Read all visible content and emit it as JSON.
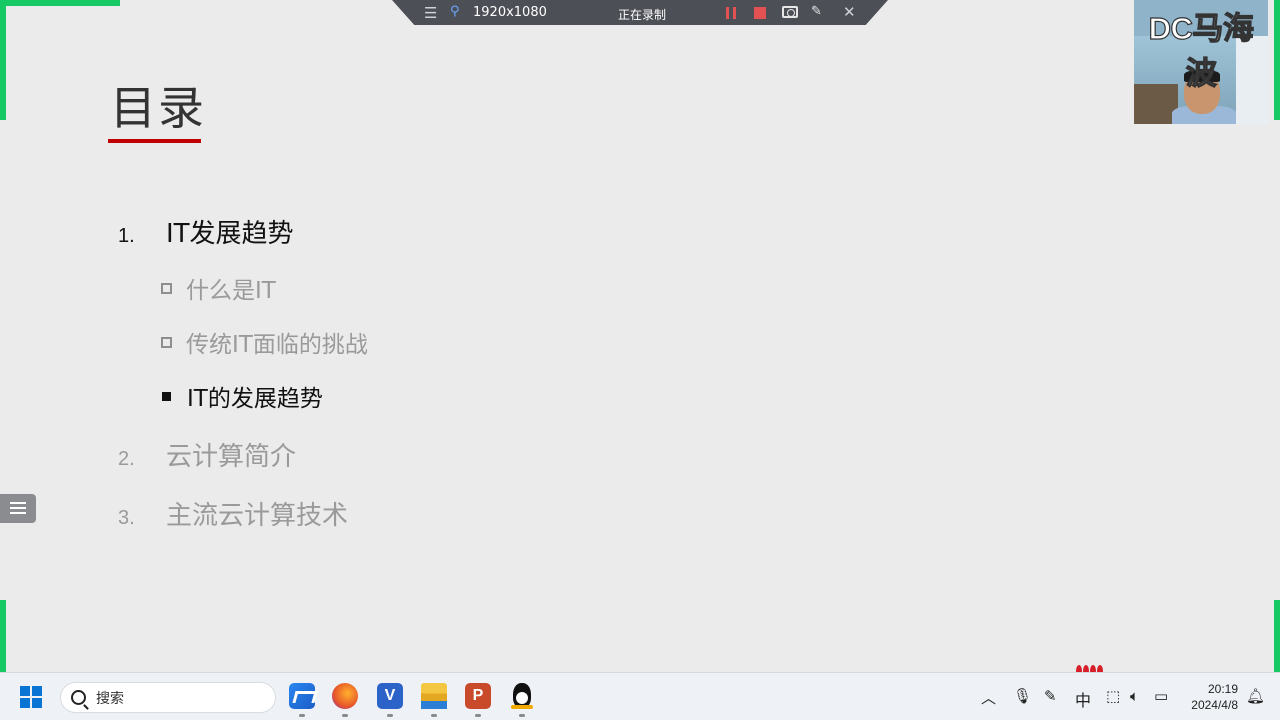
{
  "recorder": {
    "resolution": "1920x1080",
    "status": "正在录制",
    "accent_color": "#17c964",
    "controls": [
      "menu-icon",
      "pin-icon",
      "pause-icon",
      "stop-icon",
      "camera-icon",
      "pen-icon",
      "close-icon"
    ]
  },
  "webcam": {
    "watermark": "DC马海波"
  },
  "slide": {
    "title": "目录",
    "title_underline_color": "#c00000",
    "toc": [
      {
        "number": "1.",
        "label": "IT发展趋势",
        "state": "active",
        "subitems": [
          {
            "label": "什么是IT",
            "state": "dim"
          },
          {
            "label": "传统IT面临的挑战",
            "state": "dim"
          },
          {
            "label": "IT的发展趋势",
            "state": "active"
          }
        ]
      },
      {
        "number": "2.",
        "label": "云计算简介",
        "state": "dim"
      },
      {
        "number": "3.",
        "label": "主流云计算技术",
        "state": "dim"
      }
    ]
  },
  "side_tab": {
    "icon": "list-icon"
  },
  "taskbar": {
    "search_placeholder": "搜索",
    "apps": [
      {
        "name": "app-blue-icon"
      },
      {
        "name": "firefox-icon"
      },
      {
        "name": "vscode-icon",
        "glyph": "V"
      },
      {
        "name": "file-explorer-icon"
      },
      {
        "name": "powerpoint-icon",
        "glyph": "P"
      },
      {
        "name": "qq-icon"
      }
    ],
    "tray": {
      "ime": "中",
      "time": "20:19",
      "date": "2024/4/8"
    }
  }
}
